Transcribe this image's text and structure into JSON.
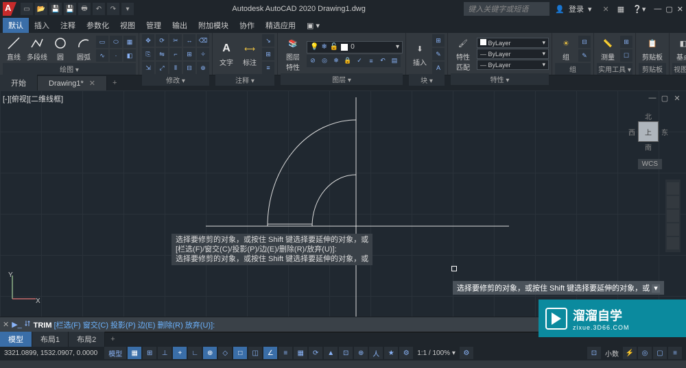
{
  "app": {
    "title": "Autodesk AutoCAD 2020   Drawing1.dwg",
    "search_placeholder": "键入关键字或短语",
    "login_text": "登录"
  },
  "menu": [
    "默认",
    "插入",
    "注释",
    "参数化",
    "视图",
    "管理",
    "输出",
    "附加模块",
    "协作",
    "精选应用"
  ],
  "ribbon": {
    "draw": {
      "title": "绘图 ▾",
      "line": "直线",
      "polyline": "多段线",
      "circle": "圆",
      "arc": "圆弧"
    },
    "modify": {
      "title": "修改 ▾"
    },
    "annot": {
      "title": "注释 ▾",
      "text": "文字",
      "dim": "标注"
    },
    "layer": {
      "title": "图层 ▾",
      "props": "图层\n特性",
      "current": "0"
    },
    "block": {
      "title": "块 ▾",
      "insert": "插入"
    },
    "props": {
      "title": "特性 ▾",
      "match": "特性\n匹配",
      "bylayer": "ByLayer"
    },
    "group": {
      "title": "组",
      "label": "组"
    },
    "util": {
      "title": "实用工具 ▾",
      "measure": "测量"
    },
    "clip": {
      "title": "剪贴板",
      "label": "剪贴板"
    },
    "base": {
      "title": "视图 ▾",
      "label": "基点"
    }
  },
  "doc_tabs": {
    "start": "开始",
    "drawing": "Drawing1*"
  },
  "viewport": {
    "label": "[-][俯视][二维线框]",
    "wcs": "WCS",
    "cube": {
      "n": "北",
      "s": "南",
      "e": "东",
      "w": "西",
      "top": "上"
    }
  },
  "tooltip": "选择要修剪的对象，或按住 Shift 键选择要延伸的对象，或",
  "cmd_history": [
    "选择要修剪的对象，或按住 Shift 键选择要延伸的对象，或",
    "[栏选(F)/窗交(C)/投影(P)/边(E)/删除(R)/放弃(U)]:",
    "选择要修剪的对象，或按住 Shift 键选择要延伸的对象，或"
  ],
  "cmd_line": {
    "prompt": "TRIM",
    "options": "[栏选(F) 窗交(C) 投影(P) 边(E) 删除(R) 放弃(U)]:"
  },
  "layout_tabs": [
    "模型",
    "布局1",
    "布局2"
  ],
  "status": {
    "coords": "3321.0899, 1532.0907, 0.0000",
    "model_btn": "模型",
    "scale": "1:1 / 100% ▾",
    "decimal": "小数"
  },
  "watermark": {
    "main": "溜溜自学",
    "sub": "zixue.3D66.COM"
  }
}
